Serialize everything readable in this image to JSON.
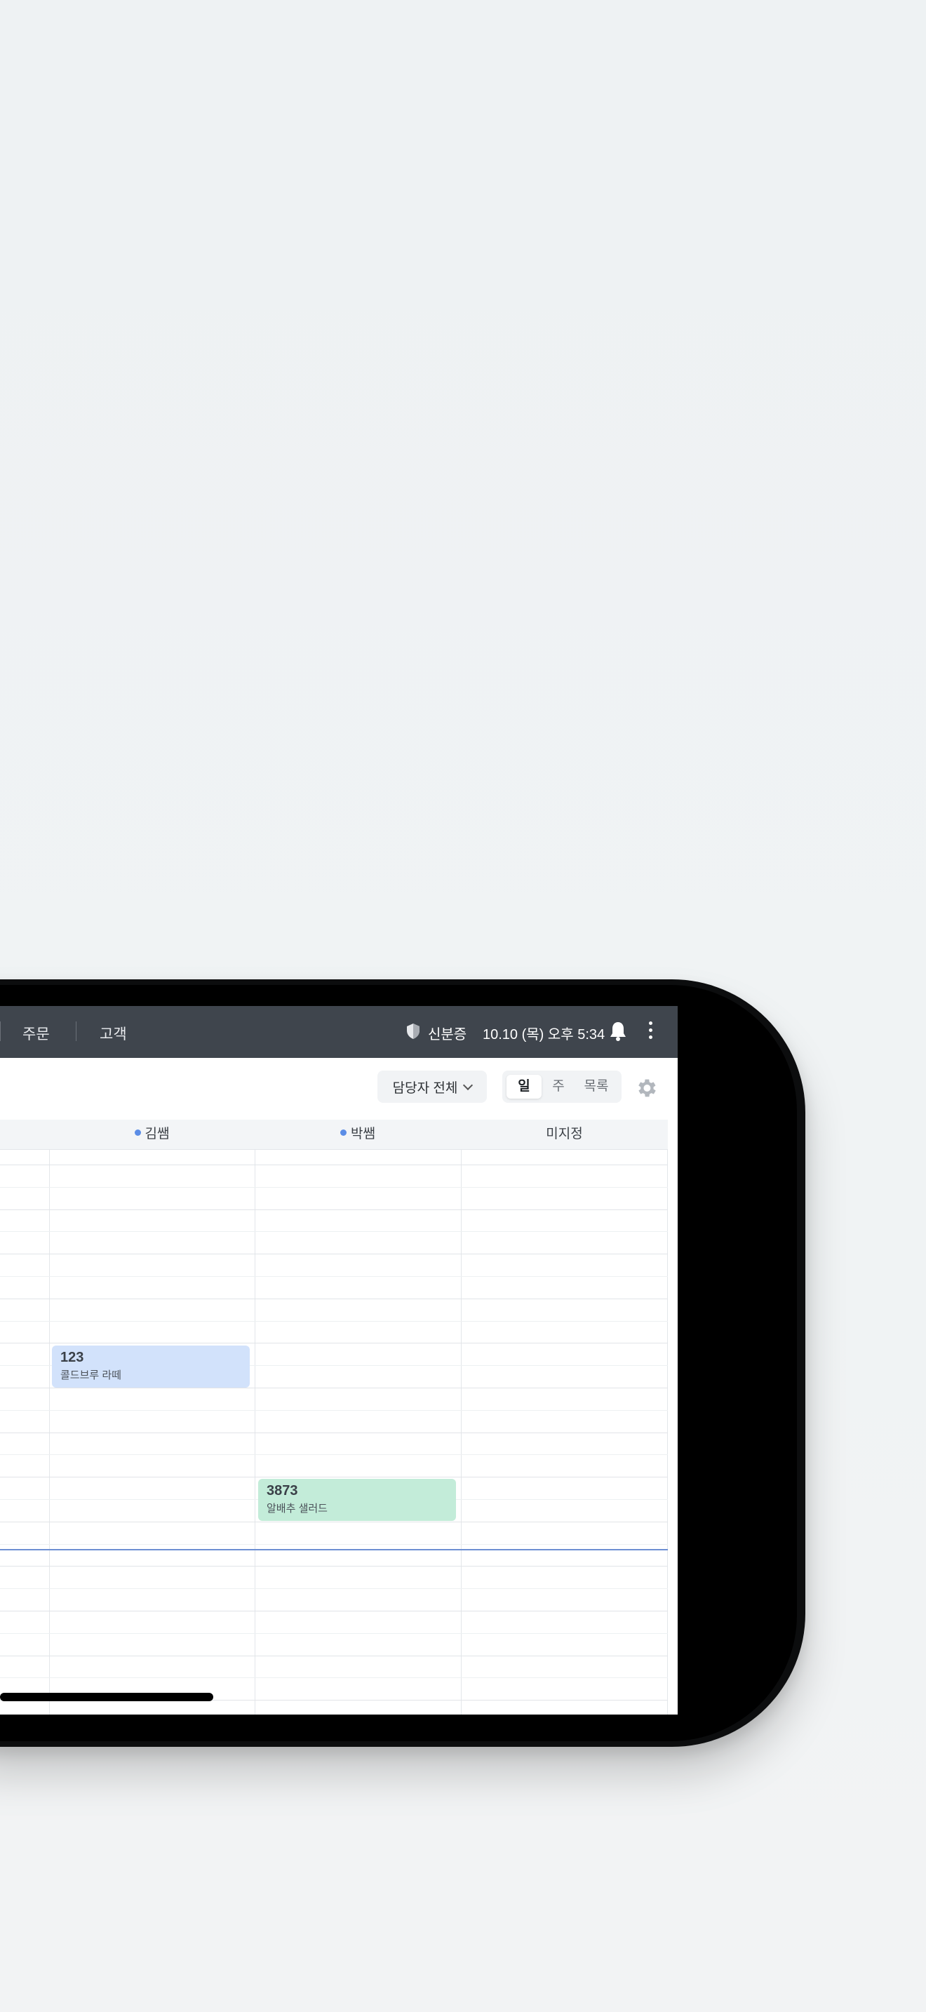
{
  "topbar": {
    "nav": [
      "주문",
      "고객"
    ],
    "id_label": "신분증",
    "datetime": "10.10 (목) 오후 5:34"
  },
  "toolbar": {
    "assignee_filter": "담당자 전체",
    "view_options": [
      "일",
      "주",
      "목록"
    ],
    "active_view": "일"
  },
  "calendar": {
    "columns": [
      {
        "label": "김쌤",
        "has_dot": true
      },
      {
        "label": "박쌤",
        "has_dot": true
      },
      {
        "label": "미지정",
        "has_dot": false
      }
    ],
    "events": [
      {
        "number": "123",
        "name": "콜드브루 라떼",
        "column": "김쌤",
        "color": "#d2e2fb"
      },
      {
        "number": "3873",
        "name": "알배추 샐러드",
        "column": "박쌤",
        "color": "#c3ecd9"
      }
    ]
  },
  "fab": {
    "label": "+"
  },
  "colors": {
    "topbar_bg": "#3f454d",
    "accent": "#4f86ec",
    "now_line": "#6d8fd3"
  }
}
